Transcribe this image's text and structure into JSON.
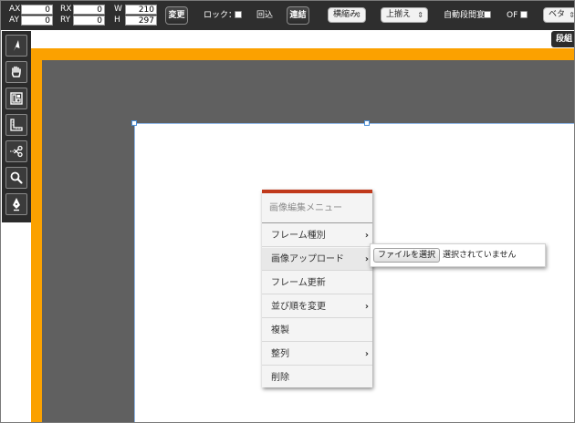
{
  "toolbar": {
    "ax_label": "AX",
    "ax_value": "0",
    "ay_label": "AY",
    "ay_value": "0",
    "rx_label": "RX",
    "rx_value": "0",
    "ry_label": "RY",
    "ry_value": "0",
    "w_label": "W",
    "w_value": "210",
    "h_label": "H",
    "h_value": "297",
    "change_button": "変更",
    "lock_label": "ロック：",
    "wrap_label": "回込",
    "link_button": "連結",
    "shrink_select": "横縮み",
    "align_select": "上揃え",
    "auto_spacing_label": "自動段間宴",
    "of_label": "OF",
    "paste_select": "ベタ"
  },
  "tooltip": {
    "text": "段組"
  },
  "palette": {
    "tools": [
      "arrow-icon",
      "hand-icon",
      "layout-icon",
      "ruler-icon",
      "scissors-icon",
      "zoom-icon",
      "pen-icon"
    ]
  },
  "context_menu": {
    "title": "画像編集メニュー",
    "items": [
      {
        "label": "フレーム種別",
        "has_submenu": true
      },
      {
        "label": "画像アップロード",
        "has_submenu": true,
        "active": true
      },
      {
        "label": "フレーム更新",
        "has_submenu": false
      },
      {
        "label": "並び順を変更",
        "has_submenu": true
      },
      {
        "label": "複製",
        "has_submenu": false
      },
      {
        "label": "整列",
        "has_submenu": true
      },
      {
        "label": "削除",
        "has_submenu": false
      }
    ],
    "accent_color": "#c0391b"
  },
  "upload_submenu": {
    "choose_file_button": "ファイルを選択",
    "status": "選択されていません"
  },
  "colors": {
    "toolbar_bg": "#2e2e2e",
    "canvas_orange": "#fba100",
    "board_gray": "#606060",
    "selection_blue": "#4a8fd8"
  }
}
